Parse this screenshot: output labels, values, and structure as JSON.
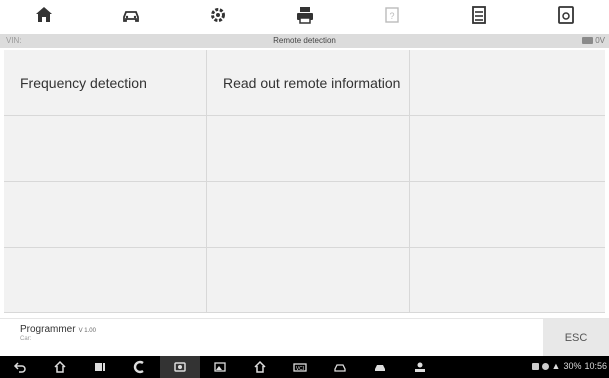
{
  "toolbar": {
    "items": [
      {
        "icon": "home-icon"
      },
      {
        "icon": "vehicle-swap-icon"
      },
      {
        "icon": "settings-gear-icon"
      },
      {
        "icon": "print-icon"
      },
      {
        "icon": "help-icon"
      },
      {
        "icon": "data-manager-icon"
      },
      {
        "icon": "screenshot-icon"
      }
    ]
  },
  "titlebar": {
    "vin_label": "VIN:",
    "title": "Remote detection",
    "voltage": "0V"
  },
  "grid": {
    "cells": [
      "Frequency detection",
      "Read out remote information",
      "",
      "",
      "",
      "",
      "",
      "",
      "",
      "",
      "",
      ""
    ]
  },
  "footer": {
    "app_name": "Programmer",
    "version": "V 1.00",
    "car_label": "Car:",
    "esc_label": "ESC"
  },
  "navbar": {
    "time": "10:56",
    "battery": "30%"
  }
}
